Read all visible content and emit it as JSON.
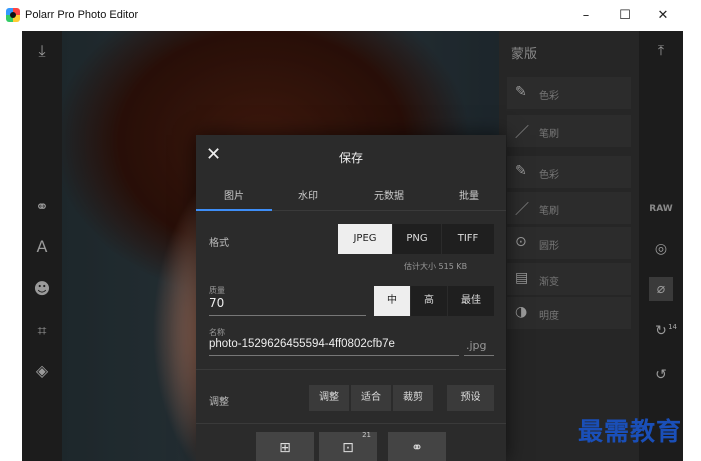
{
  "window": {
    "title": "Polarr Pro Photo Editor",
    "minimize_glyph": "–",
    "maximize_glyph": "☐",
    "close_glyph": "✕"
  },
  "left_toolbar": {
    "icons": [
      "download-icon",
      "filters-icon",
      "text-icon",
      "face-icon",
      "crop-icon",
      "layers-icon"
    ]
  },
  "right_panel": {
    "title": "蒙版",
    "items": [
      {
        "icon": "eyedropper-icon",
        "glyph": "✎",
        "label": "色彩"
      },
      {
        "icon": "brush-icon",
        "glyph": "／",
        "label": "笔刷"
      },
      {
        "icon": "eyedropper-icon",
        "glyph": "✎",
        "label": "色彩"
      },
      {
        "icon": "brush-icon",
        "glyph": "／",
        "label": "笔刷"
      },
      {
        "icon": "radial-icon",
        "glyph": "⊙",
        "label": "圆形"
      },
      {
        "icon": "gradient-icon",
        "glyph": "▤",
        "label": "渐变"
      },
      {
        "icon": "luminance-icon",
        "glyph": "◑",
        "label": "明度"
      }
    ]
  },
  "far_right_toolbar": {
    "raw_label": "RAW",
    "history_count": "14"
  },
  "dialog": {
    "close_glyph": "✕",
    "title": "保存",
    "tabs": [
      "图片",
      "水印",
      "元数据",
      "批量"
    ],
    "active_tab": "图片",
    "format": {
      "label": "格式",
      "options": [
        "JPEG",
        "PNG",
        "TIFF"
      ],
      "selected": "JPEG"
    },
    "estimated_size": "估计大小 515 KB",
    "quality": {
      "label": "质量",
      "value": "70",
      "options": [
        "中",
        "高",
        "最佳"
      ],
      "selected": "中"
    },
    "name": {
      "label": "名称",
      "value": "photo-1529626455594-4ff0802cfb7e",
      "extension": ".jpg"
    },
    "adjust": {
      "label": "调整",
      "buttons": [
        "调整",
        "适合",
        "裁剪",
        "预设"
      ]
    },
    "bottom_actions": [
      {
        "icon": "save-image-icon",
        "badge": ""
      },
      {
        "icon": "export-image-icon",
        "badge": "21"
      },
      {
        "icon": "share-icon",
        "badge": ""
      }
    ]
  },
  "watermark": "最需教育",
  "colors": {
    "accent": "#3e8ef7",
    "watermark": "#1a4fb8"
  }
}
